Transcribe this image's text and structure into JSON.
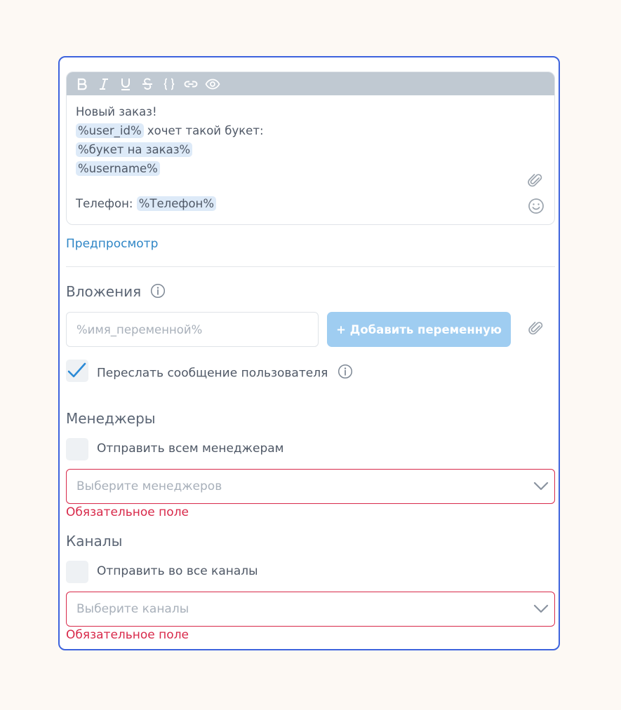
{
  "editor": {
    "toolbar": [
      "bold-icon",
      "italic-icon",
      "underline-icon",
      "strikethrough-icon",
      "code-braces-icon",
      "link-icon",
      "eye-icon"
    ],
    "line1": "Новый заказ!",
    "line2_var": "%user_id%",
    "line2_text": " хочет такой букет:",
    "line3_var": "%букет на заказ%",
    "line4_var": "%username%",
    "line5_text": "Телефон: ",
    "line5_var": "%Телефон%"
  },
  "preview_link": "Предпросмотр",
  "attachments": {
    "title": "Вложения",
    "input_placeholder": "%имя_переменной%",
    "add_button": "+ Добавить переменную",
    "forward_label": "Переслать сообщение пользователя",
    "forward_checked": true
  },
  "managers": {
    "title": "Менеджеры",
    "send_all_label": "Отправить всем менеджерам",
    "select_placeholder": "Выберите менеджеров",
    "error": "Обязательное поле"
  },
  "channels": {
    "title": "Каналы",
    "send_all_label": "Отправить во все каналы",
    "select_placeholder": "Выберите каналы",
    "error": "Обязательное поле"
  },
  "colors": {
    "accent_border": "#3d63dd",
    "button_bg": "#9fcdf1",
    "link": "#2f86c6",
    "error": "#d8294a",
    "checkmark": "#2b8ad6"
  }
}
